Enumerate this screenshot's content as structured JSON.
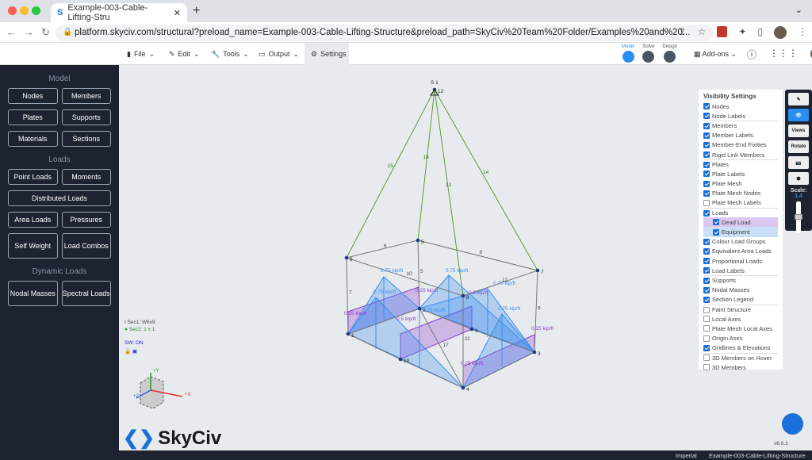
{
  "browser": {
    "tab_title": "Example-003-Cable-Lifting-Stru",
    "url": "platform.skyciv.com/structural?preload_name=Example-003-Cable-Lifting-Structure&preload_path=SkyCiv%20Team%20Folder/Examples%20and%20..."
  },
  "menu": {
    "file": "File",
    "edit": "Edit",
    "tools": "Tools",
    "output": "Output",
    "settings": "Settings",
    "addons": "Add-ons"
  },
  "steps": {
    "model": "Model",
    "solve": "Solve",
    "design": "Design"
  },
  "sidebar": {
    "model_header": "Model",
    "model_buttons": [
      "Nodes",
      "Members",
      "Plates",
      "Supports",
      "Materials",
      "Sections"
    ],
    "loads_header": "Loads",
    "loads_buttons": [
      "Point Loads",
      "Moments",
      "Distributed Loads",
      "Area Loads",
      "Pressures",
      "Self Weight",
      "Load Combos"
    ],
    "dynamic_header": "Dynamic Loads",
    "dynamic_buttons": [
      "Nodal Masses",
      "Spectral Loads"
    ]
  },
  "visibility": {
    "title": "Visibility Settings",
    "items": [
      {
        "label": "Nodes",
        "checked": true
      },
      {
        "label": "Node Labels",
        "checked": true
      },
      {
        "label": "Members",
        "checked": true,
        "sep": true
      },
      {
        "label": "Member Labels",
        "checked": true
      },
      {
        "label": "Member-End Fixities",
        "checked": true
      },
      {
        "label": "Rigid Link Members",
        "checked": true
      },
      {
        "label": "Plates",
        "checked": true,
        "sep": true
      },
      {
        "label": "Plate Labels",
        "checked": true
      },
      {
        "label": "Plate Mesh",
        "checked": true
      },
      {
        "label": "Plate Mesh Nodes",
        "checked": true
      },
      {
        "label": "Plate Mesh Labels",
        "checked": false
      },
      {
        "label": "Loads",
        "checked": true,
        "sep": true
      },
      {
        "label": "Dead Load",
        "checked": true,
        "sub": "dl"
      },
      {
        "label": "Equipment",
        "checked": true,
        "sub": "eq"
      },
      {
        "label": "Colour Load Groups",
        "checked": true
      },
      {
        "label": "Equivalent Area Loads",
        "checked": true
      },
      {
        "label": "Proportional Loads",
        "checked": true
      },
      {
        "label": "Load Labels",
        "checked": true
      },
      {
        "label": "Supports",
        "checked": true,
        "sep": true
      },
      {
        "label": "Nodal Masses",
        "checked": true
      },
      {
        "label": "Section Legend",
        "checked": true
      },
      {
        "label": "Faint Structure",
        "checked": false,
        "sep": true
      },
      {
        "label": "Local Axes",
        "checked": false
      },
      {
        "label": "Plate Mesh Local Axes",
        "checked": false
      },
      {
        "label": "Origin Axes",
        "checked": false
      },
      {
        "label": "Gridlines & Elevations",
        "checked": true
      },
      {
        "label": "3D Members on Hover",
        "checked": false,
        "sep": true
      },
      {
        "label": "3D Members",
        "checked": false
      }
    ]
  },
  "toolbox": {
    "views": "Views",
    "rotate": "Rotate",
    "scale_label": "Scale:",
    "scale_value": "1.4"
  },
  "legend": {
    "sec1": "Sec1: W6x9",
    "sec2": "Sec2: 1 x 1",
    "sw": "SW: ON"
  },
  "axes": {
    "y": "+Y",
    "x": "+X",
    "z": "+Z"
  },
  "model": {
    "top_label": "S 1",
    "nodes": [
      {
        "id": "12"
      },
      {
        "id": "6"
      },
      {
        "id": "5"
      },
      {
        "id": "7"
      },
      {
        "id": "8"
      },
      {
        "id": "1"
      },
      {
        "id": "2"
      },
      {
        "id": "9"
      },
      {
        "id": "3"
      },
      {
        "id": "10"
      },
      {
        "id": "4"
      }
    ],
    "members": [
      "6",
      "8",
      "10",
      "12",
      "7",
      "5",
      "9",
      "11",
      "17",
      "15",
      "16",
      "13",
      "14"
    ],
    "loads": [
      "0.75 kip/ft",
      "0.75 kip/ft",
      "0.75 kip/ft",
      "0.75 kip/ft",
      "0.75 kip/ft",
      "0.75 kip/ft",
      "0.25 kip/ft",
      "0.25 kip/ft",
      "0.5 kip/ft",
      "0.5 kip/ft",
      "0.25 kip/ft",
      "0.25 kip/ft"
    ],
    "colors": {
      "dead": "#8a3fd1",
      "equipment": "#3a8ef0",
      "cable": "#5a9a3a",
      "frame": "#777777"
    }
  },
  "logo": "SkyCiv",
  "version": "v6.0.1",
  "status": {
    "units": "Imperial",
    "file": "Example-003-Cable-Lifting-Structure"
  }
}
